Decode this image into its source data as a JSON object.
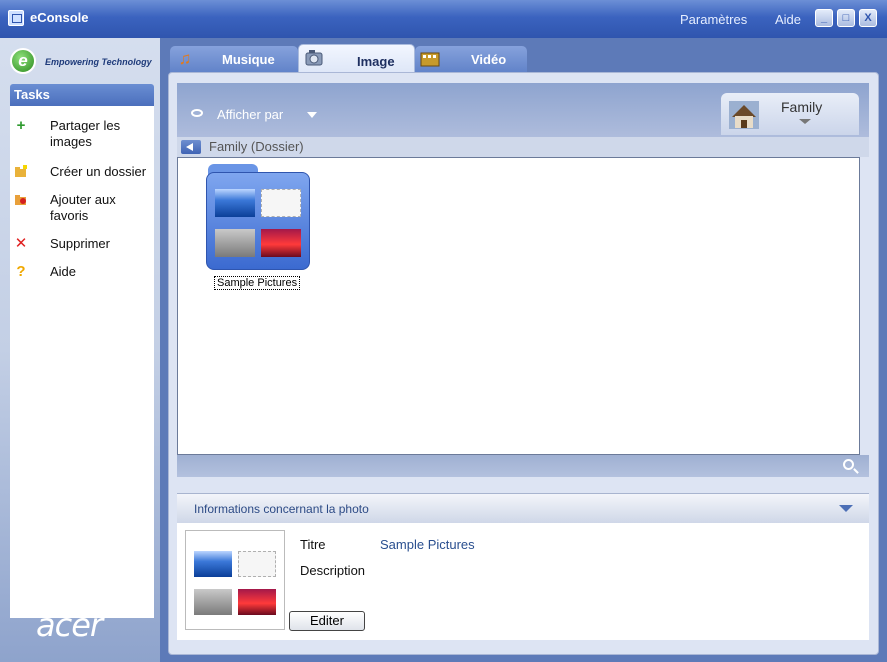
{
  "window": {
    "title": "eConsole",
    "menu": [
      "Paramètres",
      "Aide"
    ],
    "controls": {
      "minimize": "_",
      "restore": "□",
      "close": "X"
    }
  },
  "brand": {
    "tagline": "Empowering Technology",
    "logo_letter": "e",
    "vendor_logo": "acer"
  },
  "tasks": {
    "title": "Tasks",
    "items": [
      {
        "label": "Partager les images",
        "icon": "plus-icon"
      },
      {
        "label": "Créer un dossier",
        "icon": "new-folder-icon"
      },
      {
        "label": "Ajouter aux favoris",
        "icon": "favorites-folder-icon"
      },
      {
        "label": "Supprimer",
        "icon": "delete-x-icon"
      },
      {
        "label": "Aide",
        "icon": "help-icon"
      }
    ]
  },
  "tabs": [
    {
      "label": "Musique",
      "icon": "music-note-icon",
      "active": false
    },
    {
      "label": "Image",
      "icon": "camera-icon",
      "active": true
    },
    {
      "label": "Vidéo",
      "icon": "film-icon",
      "active": false
    }
  ],
  "toolbar": {
    "view_label": "Afficher par",
    "album": "Family"
  },
  "path": {
    "label": "Family (Dossier)"
  },
  "folder": {
    "name": "Sample Pictures"
  },
  "info": {
    "title": "Informations concernant la photo",
    "fields": [
      {
        "key": "Titre",
        "value": "Sample Pictures"
      },
      {
        "key": "Description",
        "value": ""
      }
    ],
    "edit_label": "Editer"
  },
  "colors": {
    "accent": "#3b63bf",
    "link": "#2a4f8f",
    "delete": "#e02020",
    "plus": "#2e9a2e",
    "help": "#f0a800"
  }
}
